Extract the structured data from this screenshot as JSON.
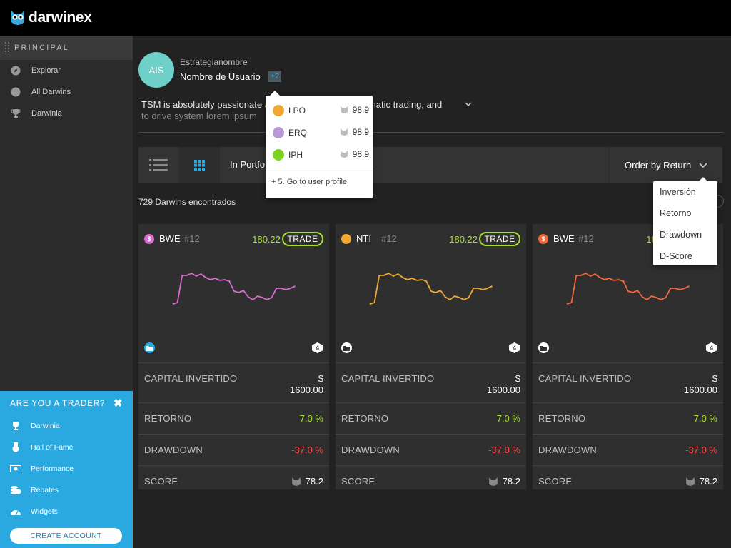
{
  "brand": {
    "name": "darwinex"
  },
  "sidebar": {
    "section": "PRINCIPAL",
    "items": [
      {
        "label": "Explorar",
        "icon": "compass-icon"
      },
      {
        "label": "All Darwins",
        "icon": "circle-icon"
      },
      {
        "label": "Darwinia",
        "icon": "trophy-icon"
      }
    ]
  },
  "promo": {
    "title": "ARE YOU A TRADER?",
    "items": [
      {
        "label": "Darwinia",
        "icon": "trophy-icon"
      },
      {
        "label": "Hall of Fame",
        "icon": "medal-icon"
      },
      {
        "label": "Performance",
        "icon": "money-icon"
      },
      {
        "label": "Rebates",
        "icon": "coins-icon"
      },
      {
        "label": "Widgets",
        "icon": "gauge-icon"
      }
    ],
    "cta": "CREATE ACCOUNT",
    "color": "#2aa9e0"
  },
  "profile": {
    "initials": "AIS",
    "strategy": "Estrategianombre",
    "username": "Nombre de Usuario",
    "badge": "+2",
    "bio_line1": "TSM is absolutely passionate about algorithmic & systematic trading, and",
    "bio_line2": "to drive system lorem ipsum"
  },
  "toolbar": {
    "filter": "In Portfolio",
    "order": "Order by Return"
  },
  "results": {
    "count_text": "729 Darwins encontrados"
  },
  "popup": {
    "items": [
      {
        "name": "LPO",
        "score": "98.9",
        "color": "#f0a830"
      },
      {
        "name": "ERQ",
        "score": "98.9",
        "color": "#b99ad6"
      },
      {
        "name": "IPH",
        "score": "98.9",
        "color": "#7ed321"
      }
    ],
    "link": "+ 5. Go to user profile"
  },
  "order_menu": {
    "options": [
      "Inversión",
      "Retorno",
      "Drawdown",
      "D-Score"
    ]
  },
  "labels": {
    "capital": "CAPITAL INVERTIDO",
    "retorno": "RETORNO",
    "drawdown": "DRAWDOWN",
    "score": "SCORE",
    "trade": "TRADE",
    "currency": "$"
  },
  "cards": [
    {
      "name": "BWE",
      "rank": "#12",
      "value": "180.22",
      "coin": "$",
      "coin_color": "#d86ad0",
      "line_color": "#d86ad0",
      "folder_color": "#2aa9e0",
      "hex": "4",
      "capital": "1600.00",
      "retorno": "7.0 %",
      "drawdown": "-37.0 %",
      "score": "78.2"
    },
    {
      "name": "NTI",
      "rank": "#12",
      "value": "180.22",
      "coin": "",
      "coin_color": "#f0a830",
      "line_color": "#f0a830",
      "folder_color": "#ffffff",
      "hex": "4",
      "capital": "1600.00",
      "retorno": "7.0 %",
      "drawdown": "-37.0 %",
      "score": "78.2"
    },
    {
      "name": "BWE",
      "rank": "#12",
      "value": "180.22",
      "coin": "$",
      "coin_color": "#f26a3a",
      "line_color": "#f26a3a",
      "folder_color": "#ffffff",
      "hex": "4",
      "capital": "1600.00",
      "retorno": "7.0 %",
      "drawdown": "-37.0 %",
      "score": "78.2"
    }
  ]
}
